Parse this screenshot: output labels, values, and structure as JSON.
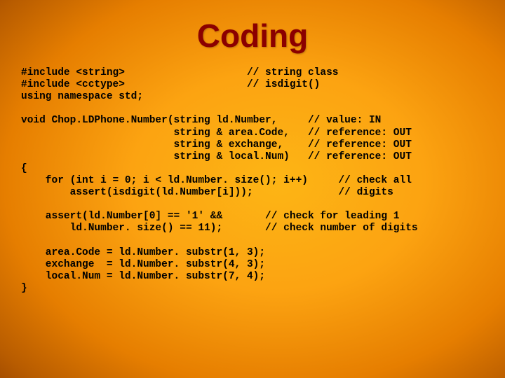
{
  "slide": {
    "title": "Coding",
    "code": "#include <string>                    // string class\n#include <cctype>                    // isdigit()\nusing namespace std;\n\nvoid Chop.LDPhone.Number(string ld.Number,     // value: IN\n                         string & area.Code,   // reference: OUT\n                         string & exchange,    // reference: OUT\n                         string & local.Num)   // reference: OUT\n{\n    for (int i = 0; i < ld.Number. size(); i++)     // check all\n        assert(isdigit(ld.Number[i]));              // digits\n\n    assert(ld.Number[0] == '1' &&       // check for leading 1\n        ld.Number. size() == 11);       // check number of digits\n\n    area.Code = ld.Number. substr(1, 3);\n    exchange  = ld.Number. substr(4, 3);\n    local.Num = ld.Number. substr(7, 4);\n}"
  }
}
